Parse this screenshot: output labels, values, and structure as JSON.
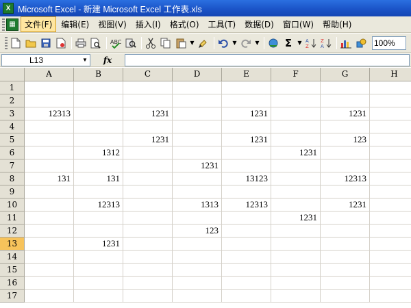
{
  "window": {
    "title": "Microsoft Excel - 新建 Microsoft Excel 工作表.xls",
    "app_icon_letter": "X"
  },
  "menu": {
    "items": [
      {
        "label": "文件(F)",
        "active": true
      },
      {
        "label": "编辑(E)"
      },
      {
        "label": "视图(V)"
      },
      {
        "label": "插入(I)"
      },
      {
        "label": "格式(O)"
      },
      {
        "label": "工具(T)"
      },
      {
        "label": "数据(D)"
      },
      {
        "label": "窗口(W)"
      },
      {
        "label": "帮助(H)"
      }
    ]
  },
  "toolbar": {
    "zoom": "100%"
  },
  "formula_bar": {
    "name_box": "L13",
    "fx_label": "fx",
    "formula": ""
  },
  "sheet": {
    "columns": [
      "A",
      "B",
      "C",
      "D",
      "E",
      "F",
      "G",
      "H"
    ],
    "rows": [
      "1",
      "2",
      "3",
      "4",
      "5",
      "6",
      "7",
      "8",
      "9",
      "10",
      "11",
      "12",
      "13",
      "14",
      "15",
      "16",
      "17"
    ],
    "selected_row": "13",
    "cells": [
      {
        "col": "A",
        "row": "3",
        "value": "12313"
      },
      {
        "col": "C",
        "row": "3",
        "value": "1231"
      },
      {
        "col": "E",
        "row": "3",
        "value": "1231"
      },
      {
        "col": "G",
        "row": "3",
        "value": "1231"
      },
      {
        "col": "C",
        "row": "5",
        "value": "1231"
      },
      {
        "col": "E",
        "row": "5",
        "value": "1231"
      },
      {
        "col": "G",
        "row": "5",
        "value": "123"
      },
      {
        "col": "B",
        "row": "6",
        "value": "1312"
      },
      {
        "col": "F",
        "row": "6",
        "value": "1231"
      },
      {
        "col": "D",
        "row": "7",
        "value": "1231"
      },
      {
        "col": "A",
        "row": "8",
        "value": "131"
      },
      {
        "col": "B",
        "row": "8",
        "value": "131"
      },
      {
        "col": "E",
        "row": "8",
        "value": "13123"
      },
      {
        "col": "G",
        "row": "8",
        "value": "12313"
      },
      {
        "col": "B",
        "row": "10",
        "value": "12313"
      },
      {
        "col": "D",
        "row": "10",
        "value": "1313"
      },
      {
        "col": "E",
        "row": "10",
        "value": "12313"
      },
      {
        "col": "G",
        "row": "10",
        "value": "1231"
      },
      {
        "col": "F",
        "row": "11",
        "value": "1231"
      },
      {
        "col": "D",
        "row": "12",
        "value": "123"
      },
      {
        "col": "B",
        "row": "13",
        "value": "1231"
      }
    ]
  }
}
